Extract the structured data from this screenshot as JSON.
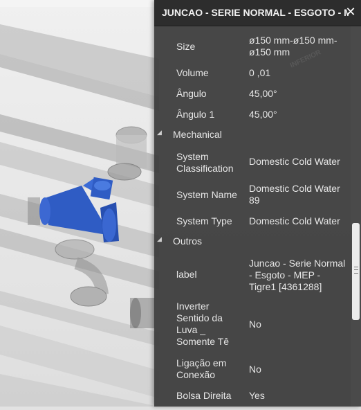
{
  "panel": {
    "title": "JUNCAO - SERIE NORMAL - ESGOTO - MEP",
    "close_glyph": "✕",
    "rows_top": [
      {
        "key": "Size",
        "value": "ø150 mm-ø150 mm-ø150 mm"
      },
      {
        "key": "Volume",
        "value": "0 ,01"
      },
      {
        "key": "Ângulo",
        "value": "45,00°"
      },
      {
        "key": "Ângulo 1",
        "value": "45,00°"
      }
    ],
    "cat_mechanical": "Mechanical",
    "rows_mechanical": [
      {
        "key": "System Classification",
        "value": "Domestic Cold Water"
      },
      {
        "key": "System Name",
        "value": "Domestic Cold Water 89"
      },
      {
        "key": "System Type",
        "value": "Domestic Cold Water"
      }
    ],
    "cat_outros": "Outros",
    "rows_outros": [
      {
        "key": "label",
        "value": "Juncao - Serie Normal - Esgoto - MEP - Tigre1 [4361288]"
      },
      {
        "key": "Inverter Sentido da Luva _ Somente Tê",
        "value": "No"
      },
      {
        "key": "Ligação em Conexão",
        "value": "No"
      },
      {
        "key": "Bolsa Direita",
        "value": "Yes"
      }
    ]
  },
  "viewport": {
    "selected_color": "#2f5cc4",
    "label_text": "INFERIOR"
  }
}
